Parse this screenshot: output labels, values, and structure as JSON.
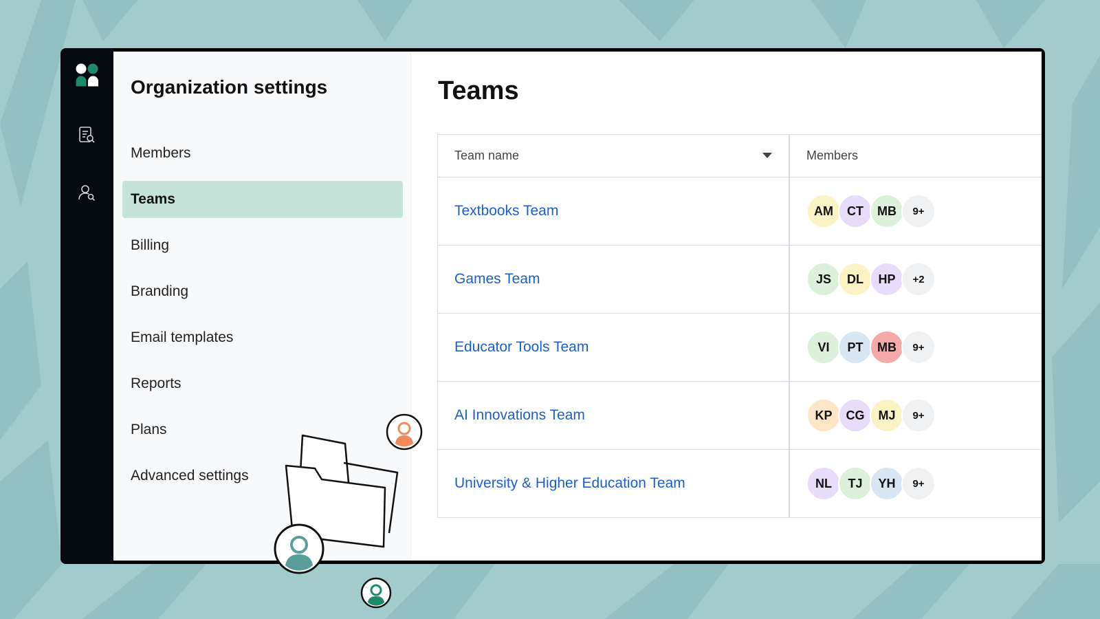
{
  "settings_nav": {
    "title": "Organization settings",
    "items": [
      {
        "label": "Members",
        "active": false
      },
      {
        "label": "Teams",
        "active": true
      },
      {
        "label": "Billing",
        "active": false
      },
      {
        "label": "Branding",
        "active": false
      },
      {
        "label": "Email templates",
        "active": false
      },
      {
        "label": "Reports",
        "active": false
      },
      {
        "label": "Plans",
        "active": false
      },
      {
        "label": "Advanced settings",
        "active": false
      }
    ]
  },
  "rail": {
    "icons": [
      "app-logo-icon",
      "document-search-icon",
      "user-search-icon"
    ]
  },
  "main": {
    "title": "Teams",
    "table": {
      "columns": [
        "Team name",
        "Members"
      ],
      "rows": [
        {
          "name": "Textbooks Team",
          "avatars": [
            {
              "initials": "AM",
              "color": "#fbf3c4"
            },
            {
              "initials": "CT",
              "color": "#e7ddfb"
            },
            {
              "initials": "MB",
              "color": "#dcf0dc"
            }
          ],
          "more": "9+"
        },
        {
          "name": "Games Team",
          "avatars": [
            {
              "initials": "JS",
              "color": "#dcf0dc"
            },
            {
              "initials": "DL",
              "color": "#fbf3c4"
            },
            {
              "initials": "HP",
              "color": "#e7ddfb"
            }
          ],
          "more": "+2"
        },
        {
          "name": "Educator Tools Team",
          "avatars": [
            {
              "initials": "VI",
              "color": "#dcf0dc"
            },
            {
              "initials": "PT",
              "color": "#d8e6f3"
            },
            {
              "initials": "MB",
              "color": "#f5a9a9"
            }
          ],
          "more": "9+"
        },
        {
          "name": "AI Innovations Team",
          "avatars": [
            {
              "initials": "KP",
              "color": "#fde6c8"
            },
            {
              "initials": "CG",
              "color": "#e7ddfb"
            },
            {
              "initials": "MJ",
              "color": "#fbf3c4"
            }
          ],
          "more": "9+"
        },
        {
          "name": "University & Higher Education Team",
          "avatars": [
            {
              "initials": "NL",
              "color": "#e7ddfb"
            },
            {
              "initials": "TJ",
              "color": "#dcf0dc"
            },
            {
              "initials": "YH",
              "color": "#d8e6f3"
            }
          ],
          "more": "9+"
        }
      ]
    }
  },
  "colors": {
    "background": "#a3cbcc",
    "rail": "#050a10",
    "active_nav": "#c6e3da",
    "link": "#1a5fd0",
    "brand_green": "#1d8a6a"
  }
}
